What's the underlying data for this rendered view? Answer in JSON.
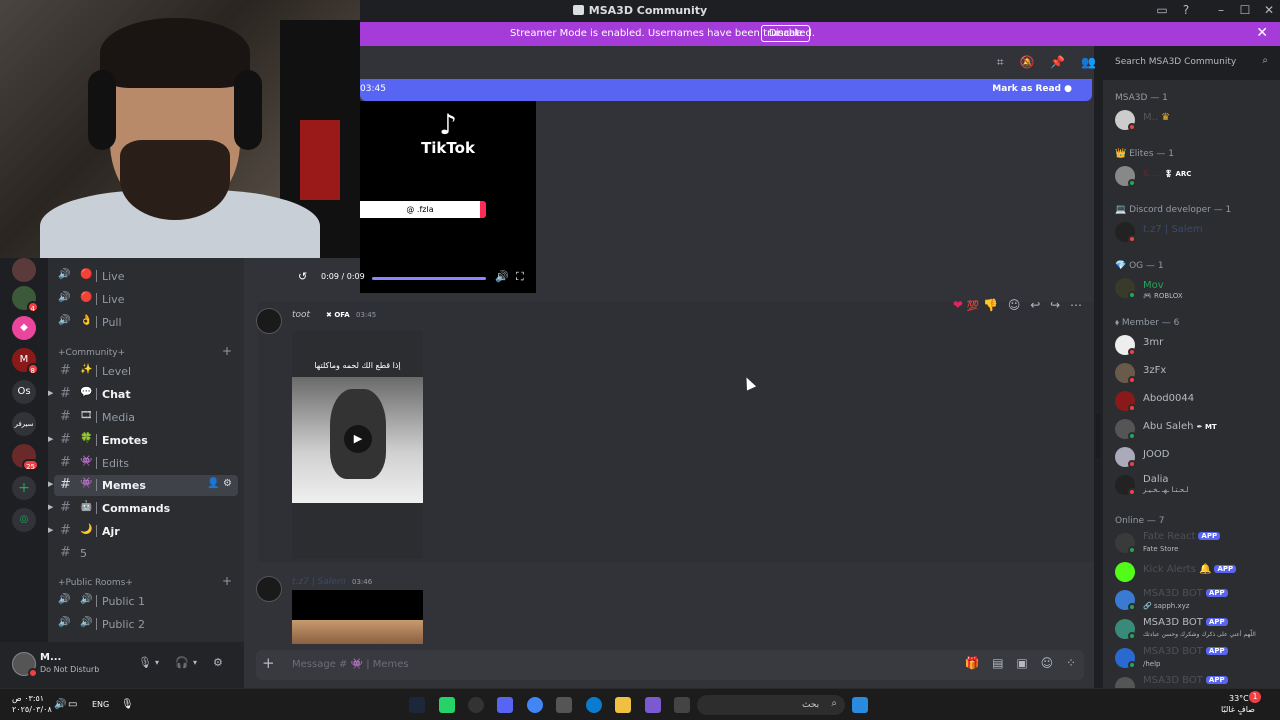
{
  "window": {
    "title": "MSA3D Community"
  },
  "banner": {
    "text": "Streamer Mode is enabled. Usernames have been truncated.",
    "button": "Disable"
  },
  "rail": {
    "items": [
      {
        "name": "server-1",
        "badge": ""
      },
      {
        "name": "server-2",
        "badge": "4"
      },
      {
        "name": "server-3",
        "badge": ""
      },
      {
        "name": "server-4",
        "badge": "8"
      },
      {
        "name": "server-os",
        "label": "Os",
        "badge": ""
      },
      {
        "name": "server-5",
        "label": "سيرفر",
        "badge": ""
      },
      {
        "name": "server-6",
        "badge": "25"
      }
    ]
  },
  "channels": {
    "live1": "Live",
    "live2": "Live",
    "pull": "Pull",
    "community_category": "+Community+",
    "level": "Level",
    "chat": "Chat",
    "media": "Media",
    "emotes": "Emotes",
    "edits": "Edits",
    "memes": "Memes",
    "commands": "Commands",
    "ajr": "Ajr",
    "five": "5",
    "public_category": "+Public Rooms+",
    "public1": "Public 1",
    "public2": "Public 2"
  },
  "user_panel": {
    "name": "M...",
    "status": "Do Not Disturb"
  },
  "main": {
    "new_messages_time": "03:45",
    "mark_as_read": "Mark as Read",
    "tiktok": {
      "brand": "TikTok",
      "handle": "@ .fzla",
      "time": "0:09 / 0:09",
      "progress": 1.0
    },
    "message1": {
      "author": "toot",
      "tag": "OFA",
      "time": "03:45",
      "caption": "إذا قطع الك لحمه وماكلتها"
    },
    "message2": {
      "author": "t.z7 | Salem",
      "time": "03:46"
    },
    "composer_placeholder": "Message # 👾 | Memes"
  },
  "search": {
    "placeholder": "Search MSA3D Community"
  },
  "members": {
    "msa3d_header": "MSA3D — 1",
    "elites_header": "Elites — 1",
    "elites_tag": "ARC",
    "devs_header": "Discord developer — 1",
    "dev_name": "t.z7 | Salem",
    "og_header": "OG — 1",
    "og_name": "Mov",
    "og_sub": "ROBLOX",
    "member_header": "Member — 6",
    "m1": "3mr",
    "m2": "3zFx",
    "m3": "Abod0044",
    "m4": "Abu Saleh",
    "m4_tag": "MT",
    "m5": "JOOD",
    "m6": "Dalia",
    "m6_sub": "لـحـتـا ـهـ ـخـيـز",
    "online_header": "Online — 7",
    "bots": [
      {
        "name": "Fate React",
        "sub": "Fate Store",
        "badge": "APP"
      },
      {
        "name": "Kick Alerts",
        "sub": "",
        "badge": "APP"
      },
      {
        "name": "MSA3D BOT",
        "sub": "sapph.xyz",
        "badge": "APP"
      },
      {
        "name": "MSA3D BOT",
        "sub": "اللّهم أعني على ذكرك وشكرك وحسن عبادتك",
        "badge": "APP"
      },
      {
        "name": "MSA3D BOT",
        "sub": "/help",
        "badge": "APP"
      },
      {
        "name": "MSA3D BOT",
        "sub": "",
        "badge": "APP"
      }
    ]
  },
  "taskbar": {
    "time": "٠٣:٥١ ص",
    "date": "٢٠٢٥/٠٣/٠٨",
    "lang": "ENG",
    "search_placeholder": "بحث",
    "weather_temp": "33°C",
    "weather_desc": "صافٍ غالبًا",
    "notification_count": "1"
  },
  "colors": {
    "accent": "#5865f2",
    "banner": "#a53bd9",
    "dnd": "#f23f43",
    "online": "#23a55a"
  }
}
